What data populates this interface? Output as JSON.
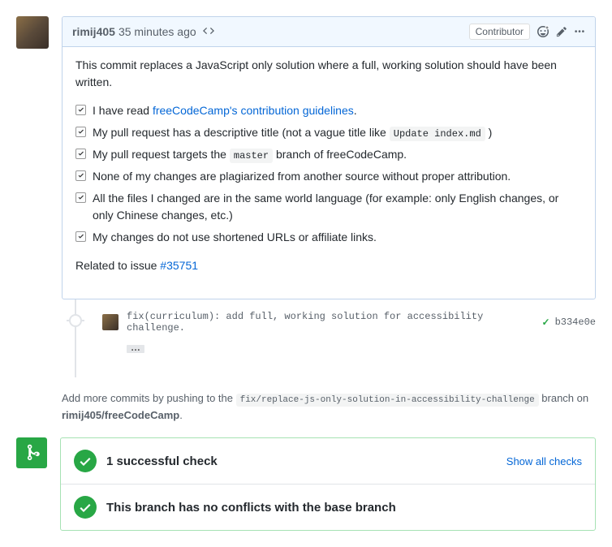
{
  "author": "rimij405",
  "timestamp": "35 minutes ago",
  "badge": "Contributor",
  "body_intro": "This commit replaces a JavaScript only solution where a full, working solution should have been written.",
  "checklist": [
    {
      "prefix": "I have read ",
      "link": "freeCodeCamp's contribution guidelines",
      "suffix": "."
    },
    {
      "prefix": "My pull request has a descriptive title (not a vague title like ",
      "code": "Update index.md",
      "suffix": " )"
    },
    {
      "prefix": "My pull request targets the ",
      "code": "master",
      "suffix": " branch of freeCodeCamp."
    },
    {
      "text": "None of my changes are plagiarized from another source without proper attribution."
    },
    {
      "text": "All the files I changed are in the same world language (for example: only English changes, or only Chinese changes, etc.)"
    },
    {
      "text": "My changes do not use shortened URLs or affiliate links."
    }
  ],
  "related_prefix": "Related to issue ",
  "related_issue": "#35751",
  "commit": {
    "message": "fix(curriculum): add full, working solution for accessibility challenge.",
    "sha": "b334e0e"
  },
  "tip_prefix": "Add more commits by pushing to the ",
  "tip_branch": "fix/replace-js-only-solution-in-accessibility-challenge",
  "tip_middle": " branch on ",
  "tip_repo": "rimij405/freeCodeCamp",
  "tip_suffix": ".",
  "merge": {
    "checks_label": "1 successful check",
    "show_all": "Show all checks",
    "conflicts_label": "This branch has no conflicts with the base branch"
  },
  "colors": {
    "success": "#28a745",
    "link": "#0366d6",
    "header_bg": "#f1f8ff",
    "border": "#c0d3eb"
  }
}
